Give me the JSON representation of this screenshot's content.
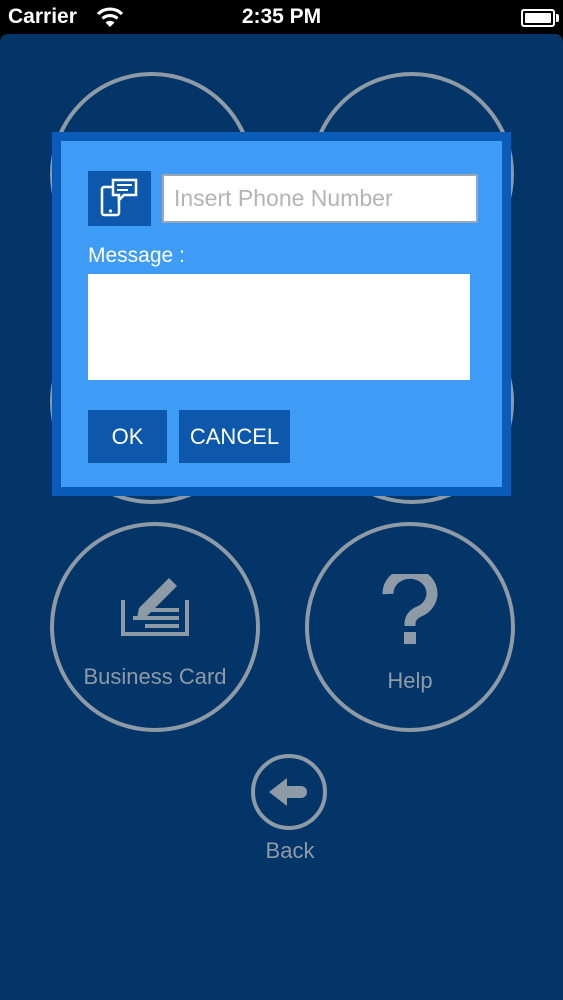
{
  "status_bar": {
    "carrier": "Carrier",
    "time": "2:35 PM"
  },
  "tiles": [
    {
      "label": "Business Card",
      "icon": "business-card-icon"
    },
    {
      "label": "Help",
      "icon": "help-icon"
    }
  ],
  "back": {
    "label": "Back",
    "icon": "back-arrow-icon"
  },
  "dialog": {
    "phone_placeholder": "Insert Phone Number",
    "message_label": "Message :",
    "message_value": "",
    "ok_label": "OK",
    "cancel_label": "CANCEL",
    "icon": "sms-phone-icon"
  },
  "colors": {
    "background": "#043568",
    "dialog_border": "#0a5cb8",
    "dialog_fill": "#3e9bf6",
    "button": "#0d58ad",
    "tile_outline": "#8e9aa6"
  }
}
